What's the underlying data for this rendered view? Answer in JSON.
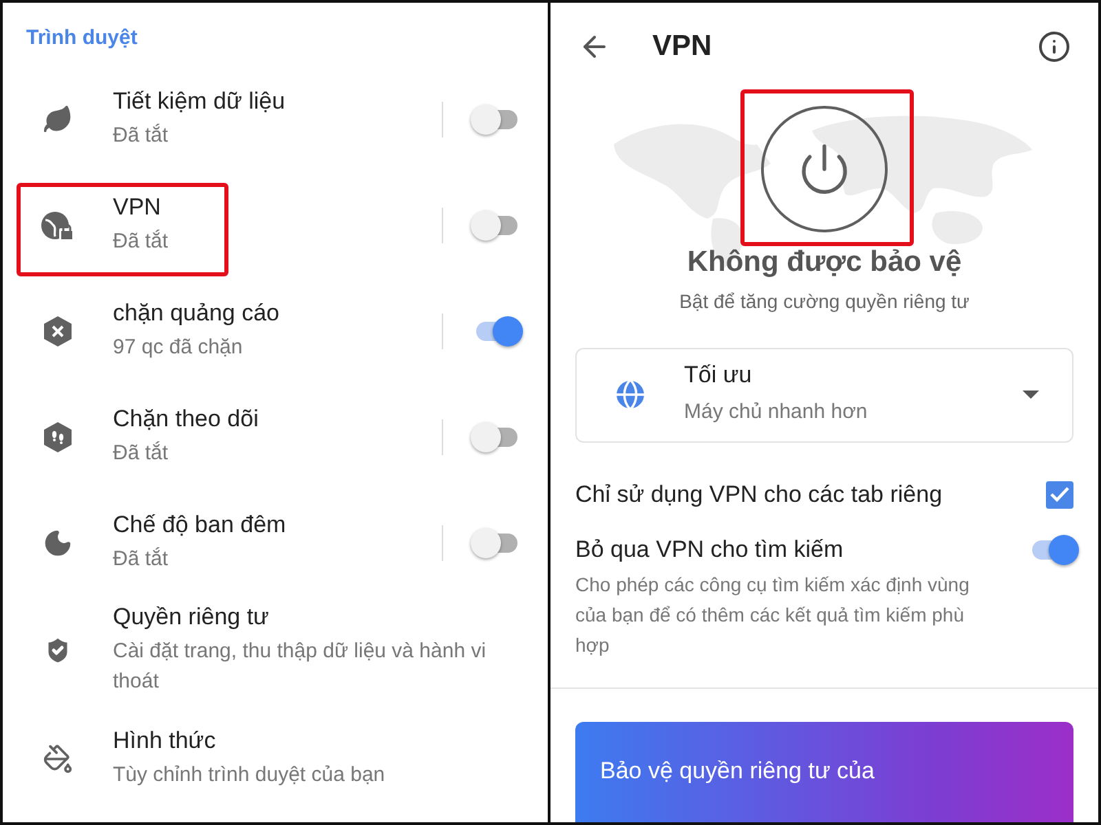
{
  "left": {
    "section_title": "Trình duyệt",
    "items": [
      {
        "title": "Tiết kiệm dữ liệu",
        "subtitle": "Đã tắt",
        "kind": "toggle",
        "on": false,
        "highlighted": false
      },
      {
        "title": "VPN",
        "subtitle": "Đã tắt",
        "kind": "toggle",
        "on": false,
        "highlighted": true
      },
      {
        "title": "chặn quảng cáo",
        "subtitle": "97 qc đã chặn",
        "kind": "toggle",
        "on": true,
        "highlighted": false
      },
      {
        "title": "Chặn theo dõi",
        "subtitle": "Đã tắt",
        "kind": "toggle",
        "on": false,
        "highlighted": false
      },
      {
        "title": "Chế độ ban đêm",
        "subtitle": "Đã tắt",
        "kind": "toggle",
        "on": false,
        "highlighted": false
      },
      {
        "title": "Quyền riêng tư",
        "subtitle": "Cài đặt trang, thu thập dữ liệu và hành vi thoát",
        "kind": "link",
        "highlighted": false
      },
      {
        "title": "Hình thức",
        "subtitle": "Tùy chỉnh trình duyệt của bạn",
        "kind": "link",
        "highlighted": false
      }
    ]
  },
  "right": {
    "title": "VPN",
    "power": {
      "highlighted": true
    },
    "status": "Không được bảo vệ",
    "status_hint": "Bật để tăng cường quyền riêng tư",
    "location": {
      "name": "Tối ưu",
      "detail": "Máy chủ nhanh hơn"
    },
    "options": [
      {
        "kind": "checkbox",
        "label": "Chỉ sử dụng VPN cho các tab riêng",
        "checked": true
      },
      {
        "kind": "toggle",
        "label": "Bỏ qua VPN cho tìm kiếm",
        "on": true,
        "description": "Cho phép các công cụ tìm kiếm xác định vùng của bạn để có thêm các kết quả tìm kiếm phù hợp"
      }
    ],
    "promo": {
      "text": "Bảo vệ quyền riêng tư của"
    }
  }
}
